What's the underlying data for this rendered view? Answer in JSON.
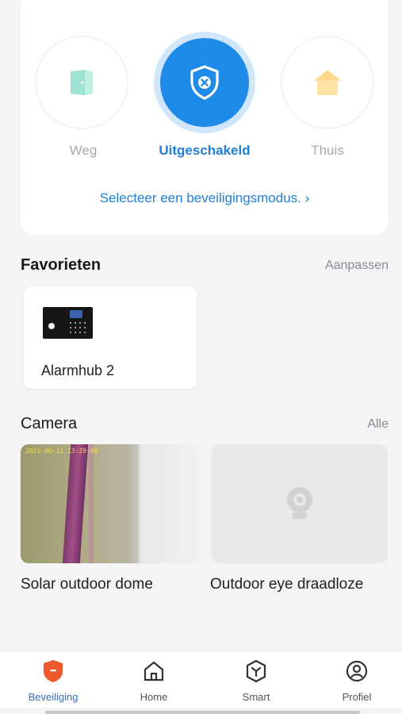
{
  "modes": {
    "away_label": "Weg",
    "disarmed_label": "Uitgeschakeld",
    "home_label": "Thuis",
    "select_link": "Selecteer een beveiligingsmodus. ›",
    "active": "disarmed",
    "accent_color": "#1f8be8"
  },
  "favorites": {
    "title": "Favorieten",
    "edit_label": "Aanpassen",
    "items": [
      {
        "label": "Alarmhub 2",
        "icon": "alarm-hub-thumbnail"
      }
    ]
  },
  "camera": {
    "title": "Camera",
    "all_label": "Alle",
    "items": [
      {
        "label": "Solar outdoor dome",
        "timestamp": "2023-06-11 13:29:08"
      },
      {
        "label": "Outdoor eye draadlozе",
        "icon": "camera-placeholder-icon"
      }
    ]
  },
  "tabs": [
    {
      "label": "Beveiliging",
      "icon": "shield-icon",
      "active": true
    },
    {
      "label": "Home",
      "icon": "house-icon",
      "active": false
    },
    {
      "label": "Smart",
      "icon": "smart-icon",
      "active": false
    },
    {
      "label": "Profiel",
      "icon": "profile-icon",
      "active": false
    }
  ]
}
